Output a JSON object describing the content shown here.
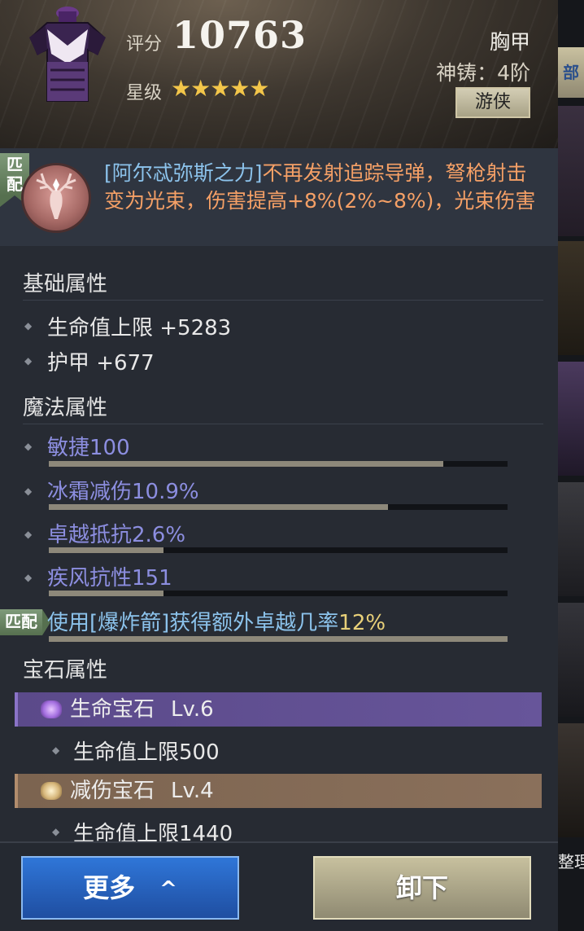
{
  "item": {
    "score_label": "评分",
    "score": "10763",
    "star_label": "星级",
    "stars": "★★★★★",
    "star_count": 5,
    "type": "胸甲",
    "forge": "神铸：4阶",
    "class_badge": "游侠"
  },
  "set_bonus": {
    "match_tag": "匹配",
    "name": "[阿尔忒弥斯之力]",
    "description": "不再发射追踪导弹，弩枪射击变为光束，伤害提高+8%(2%~8%)，光束伤害",
    "icon": "stag-emblem-icon"
  },
  "base_attributes": {
    "title": "基础属性",
    "items": [
      "生命值上限 +5283",
      "护甲 +677"
    ]
  },
  "magic_attributes": {
    "title": "魔法属性",
    "items": [
      {
        "label": "敏捷100",
        "fill": 0.86
      },
      {
        "label": "冰霜减伤10.9%",
        "fill": 0.74
      },
      {
        "label": "卓越抵抗2.6%",
        "fill": 0.25
      },
      {
        "label": "疾风抗性151",
        "fill": 0.25
      }
    ],
    "match_tag": "匹配",
    "match_effect": "使用[爆炸箭]获得额外卓越几率",
    "match_value": "12%"
  },
  "gem_attributes": {
    "title": "宝石属性",
    "gems": [
      {
        "name": "生命宝石",
        "level": "Lv.6",
        "stat": "生命值上限500",
        "color": "#67559a"
      },
      {
        "name": "减伤宝石",
        "level": "Lv.4",
        "stat": "生命值上限1440",
        "color": "#8a705b"
      }
    ]
  },
  "buttons": {
    "more": "更多",
    "more_arrow": "^",
    "unequip": "卸下"
  },
  "side_strip": {
    "tab_label": "部",
    "bottom_label": "整理"
  },
  "colors": {
    "set_text": "#f5a066",
    "set_name": "#8cc3ec",
    "magic_text": "#8c8ee0",
    "star": "#f3c64a",
    "btn_more": "#2f76d8",
    "btn_unequip": "#c7c09e"
  }
}
